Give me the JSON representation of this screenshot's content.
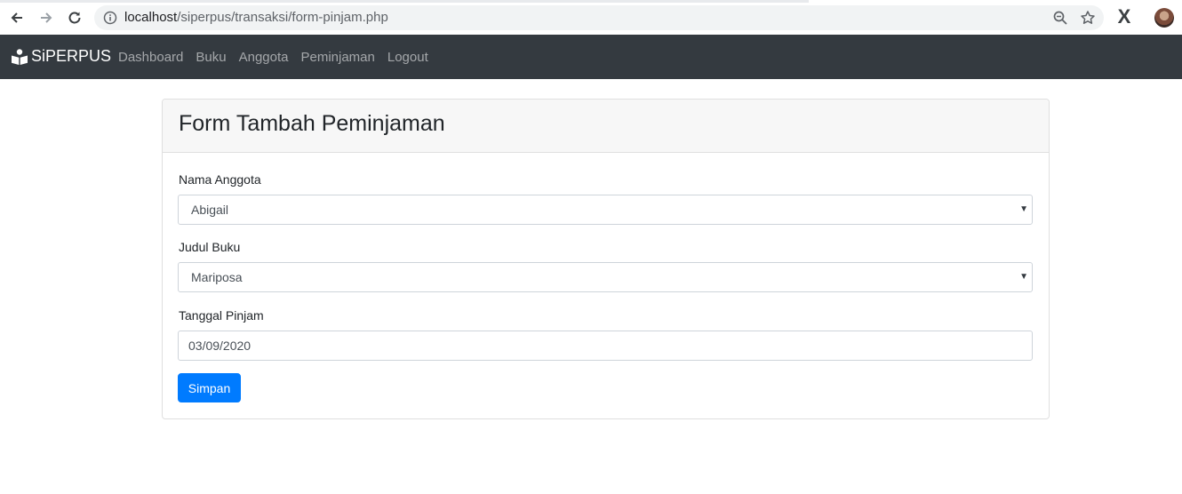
{
  "browser": {
    "url_host": "localhost",
    "url_path": "/siperpus/transaksi/form-pinjam.php",
    "icons": [
      "back-icon",
      "forward-icon",
      "reload-icon",
      "info-icon",
      "zoom-icon",
      "star-icon",
      "extension-icon",
      "profile-avatar"
    ]
  },
  "navbar": {
    "brand": "SiPERPUS",
    "links": [
      "Dashboard",
      "Buku",
      "Anggota",
      "Peminjaman",
      "Logout"
    ],
    "bg_color": "#343a40"
  },
  "form": {
    "title": "Form Tambah Peminjaman",
    "member_label": "Nama Anggota",
    "member_value": "Abigail",
    "book_label": "Judul Buku",
    "book_value": "Mariposa",
    "date_label": "Tanggal Pinjam",
    "date_value": "03/09/2020",
    "submit_label": "Simpan",
    "submit_color": "#007bff"
  }
}
